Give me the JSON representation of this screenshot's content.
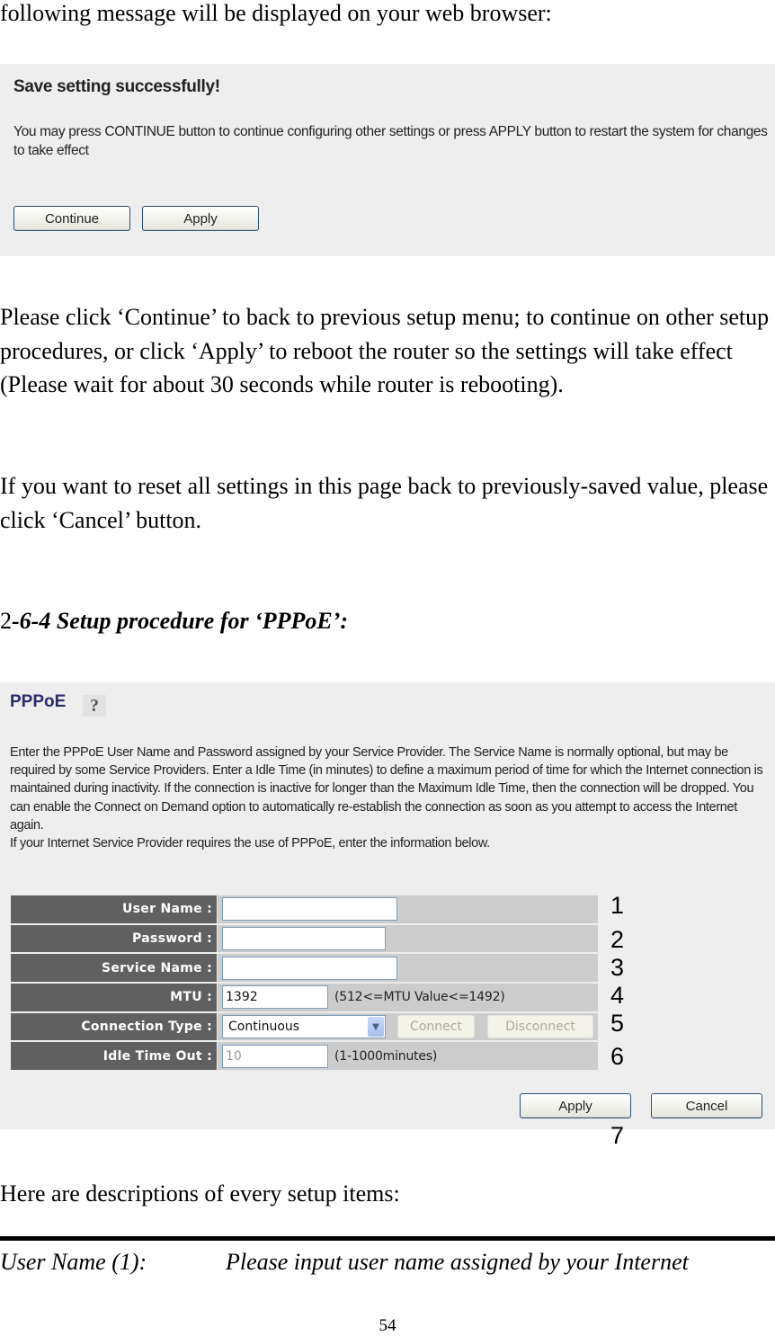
{
  "intro_line": "following message will be displayed on your web browser:",
  "save_dialog": {
    "title": "Save setting successfully!",
    "message": "You may press CONTINUE button to continue configuring other settings or press APPLY button to restart the system for changes to take effect",
    "continue_label": "Continue",
    "apply_label": "Apply"
  },
  "paragraphs": {
    "p1": "Please click ‘Continue’ to back to previous setup menu; to continue on other setup procedures, or click ‘Apply’ to reboot the router so the settings will take effect (Please wait for about 30 seconds while router is rebooting).",
    "p2": "If you want to reset all settings in this page back to previously-saved value, please click ‘Cancel’ button.",
    "p3": "Here are descriptions of every setup items:"
  },
  "section_heading": {
    "prefix": "2",
    "text": "-6-4 Setup procedure for ‘PPPoE’:"
  },
  "pppoe": {
    "title": "PPPoE",
    "help_icon_glyph": "?",
    "description": "Enter the PPPoE User Name and Password assigned by your Service Provider. The Service Name is normally optional, but may be required by some Service Providers. Enter a Idle Time (in minutes) to define a maximum period of time for which the Internet connection is maintained during inactivity. If the connection is inactive for longer than the Maximum Idle Time, then the connection will be dropped. You can enable the Connect on Demand option to automatically re-establish the connection as soon as you attempt to access the Internet again.\nIf your Internet Service Provider requires the use of PPPoE, enter the information below.",
    "fields": {
      "user_name": {
        "label": "User Name :",
        "value": ""
      },
      "password": {
        "label": "Password :",
        "value": ""
      },
      "service_name": {
        "label": "Service Name :",
        "value": ""
      },
      "mtu": {
        "label": "MTU :",
        "value": "1392",
        "hint": "(512<=MTU Value<=1492)"
      },
      "connection_type": {
        "label": "Connection Type :",
        "selected": "Continuous",
        "connect_label": "Connect",
        "disconnect_label": "Disconnect"
      },
      "idle_time_out": {
        "label": "Idle Time Out :",
        "value": "10",
        "hint": "(1-1000minutes)"
      }
    },
    "apply_label": "Apply",
    "cancel_label": "Cancel"
  },
  "callouts": [
    "1",
    "2",
    "3",
    "4",
    "5",
    "6",
    "7"
  ],
  "description_item": {
    "term": "User Name (1):",
    "definition": "Please input user name assigned by your Internet"
  },
  "page_number": "54",
  "colors": {
    "panel_bg": "#eeeeee",
    "label_bg": "#606060",
    "value_bg": "#cccccc",
    "title_color": "#2b2d6b",
    "button_border": "#2a4f7a",
    "input_border": "#7f9db9"
  }
}
